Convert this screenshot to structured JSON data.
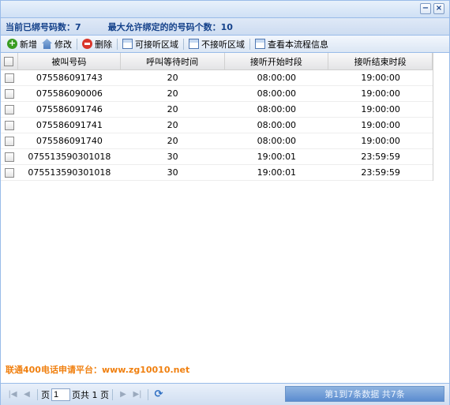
{
  "window": {
    "minimize_label": "−",
    "close_label": "×"
  },
  "summary": {
    "bound_count_text": "当前已绑号码数：7",
    "max_allowed_text": "最大允许绑定的的号码个数：10"
  },
  "toolbar": {
    "add_label": "新增",
    "edit_label": "修改",
    "delete_label": "删除",
    "allowed_area_label": "可接听区域",
    "blocked_area_label": "不接听区域",
    "view_flow_label": "查看本流程信息"
  },
  "grid": {
    "headers": [
      "被叫号码",
      "呼叫等待时间",
      "接听开始时段",
      "接听结束时段"
    ],
    "rows": [
      [
        "075586091743",
        "20",
        "08:00:00",
        "19:00:00"
      ],
      [
        "075586090006",
        "20",
        "08:00:00",
        "19:00:00"
      ],
      [
        "075586091746",
        "20",
        "08:00:00",
        "19:00:00"
      ],
      [
        "075586091741",
        "20",
        "08:00:00",
        "19:00:00"
      ],
      [
        "075586091740",
        "20",
        "08:00:00",
        "19:00:00"
      ],
      [
        "075513590301018",
        "30",
        "19:00:01",
        "23:59:59"
      ],
      [
        "075513590301018",
        "30",
        "19:00:01",
        "23:59:59"
      ]
    ]
  },
  "footer": {
    "promo_text": "联通400电话申请平台：www.zg10010.net"
  },
  "pager": {
    "first_icon": "first-page-icon",
    "prev_icon": "prev-page-icon",
    "page_prefix": "页",
    "page_value": "1",
    "page_suffix": "页共 1 页",
    "next_icon": "next-page-icon",
    "last_icon": "last-page-icon",
    "refresh_icon": "refresh-icon",
    "info_text": "第1到7条数据 共7条"
  }
}
